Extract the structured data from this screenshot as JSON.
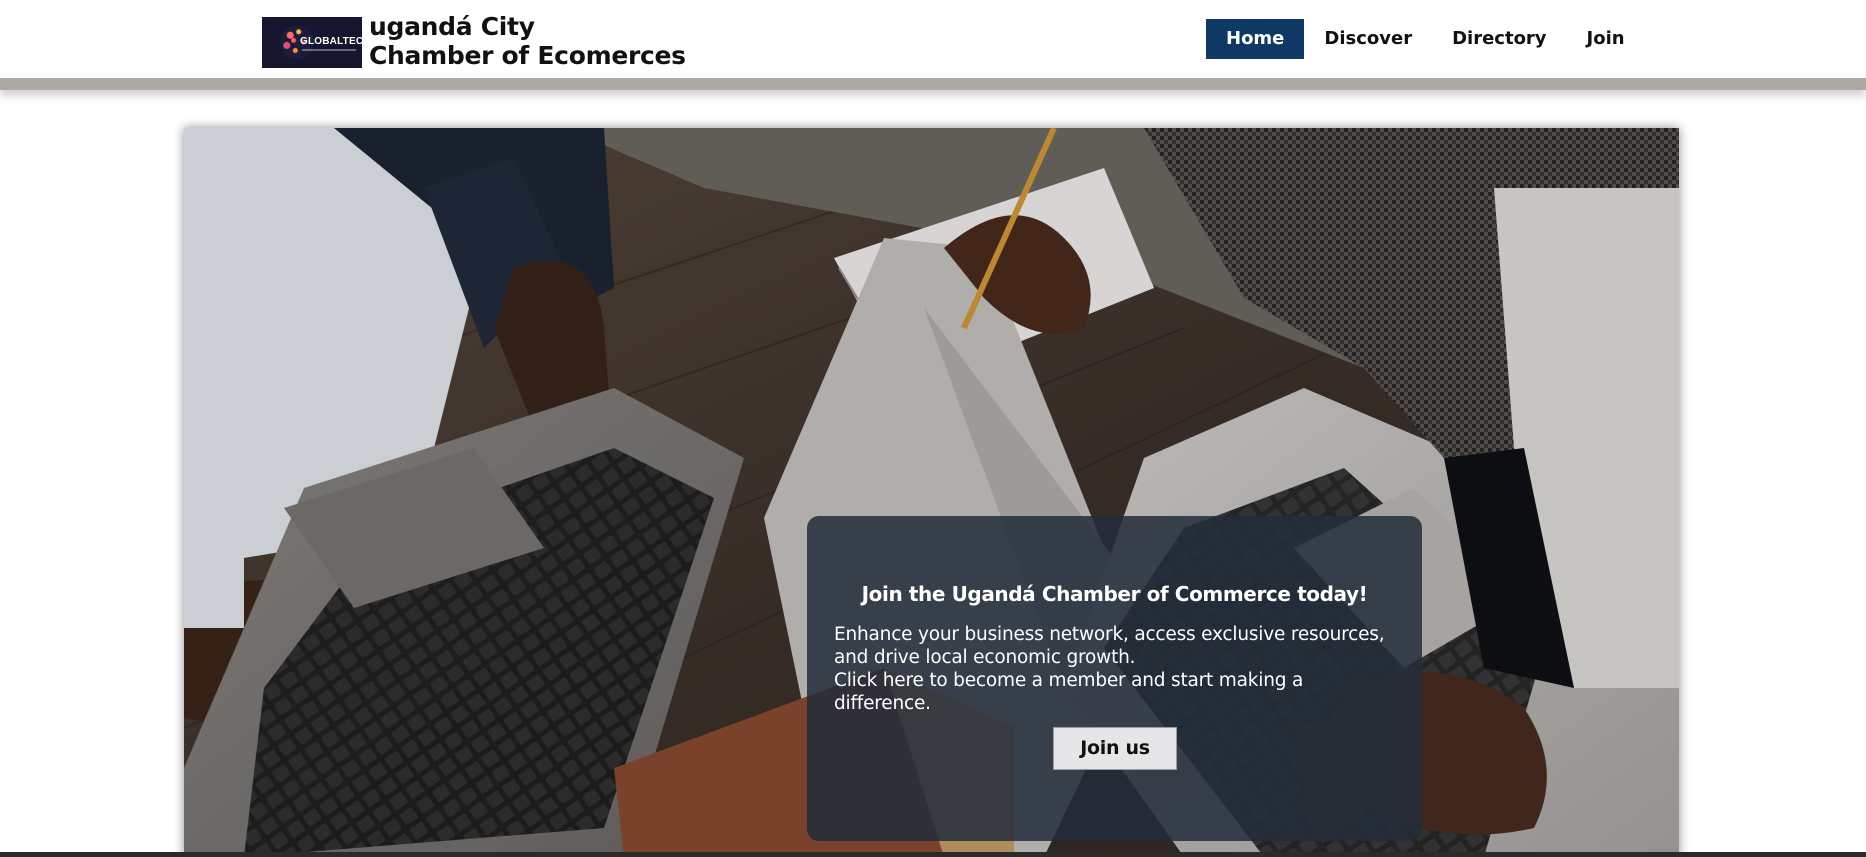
{
  "header": {
    "logo_text": "GLOBALTECH",
    "title_line1": "ugandá City",
    "title_line2": "Chamber of Ecomerces"
  },
  "nav": {
    "items": [
      {
        "label": "Home",
        "active": true
      },
      {
        "label": "Discover",
        "active": false
      },
      {
        "label": "Directory",
        "active": false
      },
      {
        "label": "Join",
        "active": false
      }
    ]
  },
  "hero": {
    "image": "business-meeting-laptops-photo",
    "card": {
      "heading": "Join the Ugandá Chamber of Commerce today!",
      "paragraph1": "Enhance your business network, access exclusive resources, and drive local economic growth.",
      "paragraph2": "Click here to become a member and start making a difference.",
      "button_label": "Join us"
    }
  },
  "colors": {
    "nav_active_bg": "#0f3866",
    "header_border": "#aca8a3",
    "card_bg": "#232c3a",
    "button_bg": "#e6e6e8"
  }
}
